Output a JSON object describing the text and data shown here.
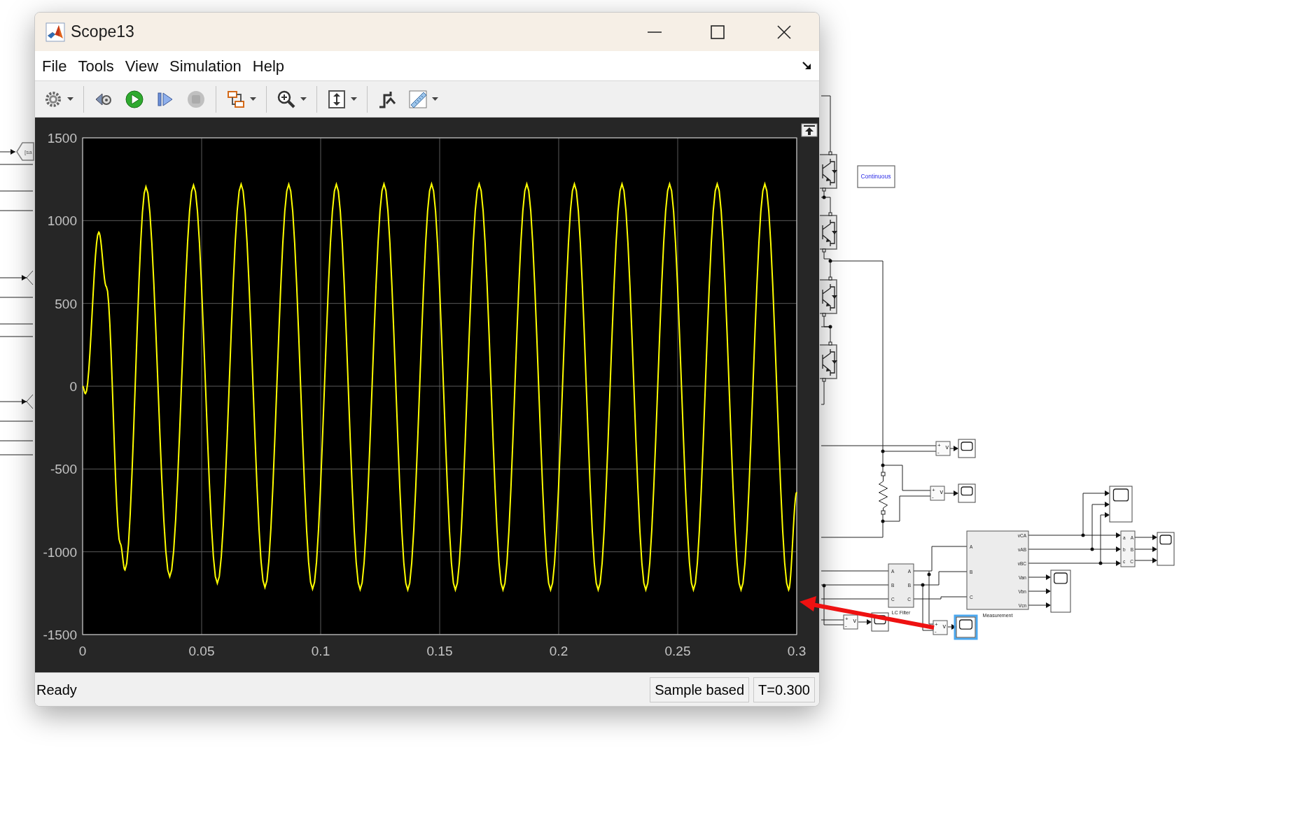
{
  "window": {
    "title": "Scope13"
  },
  "menu": [
    "File",
    "Tools",
    "View",
    "Simulation",
    "Help"
  ],
  "toolbar": [
    [
      {
        "kind": "settings",
        "dropdown": true,
        "disabled": false
      }
    ],
    [
      {
        "kind": "rewind",
        "dropdown": false,
        "disabled": false
      },
      {
        "kind": "run",
        "dropdown": false,
        "disabled": false
      },
      {
        "kind": "step",
        "dropdown": false,
        "disabled": false
      },
      {
        "kind": "stop",
        "dropdown": false,
        "disabled": true
      }
    ],
    [
      {
        "kind": "layout",
        "dropdown": true,
        "disabled": false
      }
    ],
    [
      {
        "kind": "zoom",
        "dropdown": true,
        "disabled": false
      }
    ],
    [
      {
        "kind": "fit",
        "dropdown": true,
        "disabled": false
      }
    ],
    [
      {
        "kind": "trigger",
        "dropdown": false,
        "disabled": false
      },
      {
        "kind": "measure",
        "dropdown": true,
        "disabled": false
      }
    ]
  ],
  "plot": {
    "chart_data": {
      "type": "line",
      "grid": true,
      "xlim": [
        0,
        0.3
      ],
      "ylim": [
        -1500,
        1500
      ],
      "xticks": [
        0,
        0.05,
        0.1,
        0.15,
        0.2,
        0.25,
        0.3
      ],
      "yticks": [
        -1500,
        -1000,
        -500,
        0,
        500,
        1000,
        1500
      ],
      "x": [
        0,
        0.0012,
        0.0068,
        0.01,
        0.0158,
        0.0178,
        0.0266,
        0.0366,
        0.0466,
        0.0566,
        0.0666,
        0.0766,
        0.0866,
        0.0966,
        0.1066,
        0.1166,
        0.1266,
        0.1366,
        0.1466,
        0.1566,
        0.1666,
        0.1766,
        0.1866,
        0.1966,
        0.2066,
        0.2166,
        0.2266,
        0.2366,
        0.2466,
        0.2566,
        0.2666,
        0.2766,
        0.2866,
        0.2966,
        0.3
      ],
      "series": [
        {
          "color": "#ffff00",
          "values": [
            0,
            -45,
            930,
            600,
            -950,
            -1110,
            1205,
            -1150,
            1215,
            -1190,
            1220,
            -1215,
            1220,
            -1225,
            1220,
            -1228,
            1222,
            -1230,
            1222,
            -1230,
            1222,
            -1230,
            1222,
            -1230,
            1222,
            -1230,
            1222,
            -1230,
            1222,
            -1230,
            1222,
            -1230,
            1222,
            -1230,
            -640
          ]
        }
      ]
    }
  },
  "status_bar": {
    "message": "Ready",
    "mode": "Sample based",
    "time": "T=0.300"
  },
  "diagram": {
    "goto_tag": "[sa",
    "solver_block": "Continuous",
    "lc_filter": {
      "name": "LC Filter",
      "inputs": [
        "A",
        "B",
        "C"
      ],
      "outputs": [
        "A",
        "B",
        "C"
      ]
    },
    "measurement": {
      "name": "Measurement",
      "inputs": [
        "A",
        "B",
        "C"
      ],
      "outputs": [
        "vCA",
        "vAB",
        "vBC",
        "Van",
        "Vbn",
        "Vcn"
      ]
    },
    "transform": {
      "inputs": [
        "a",
        "b",
        "c"
      ],
      "outputs": [
        "A",
        "B",
        "C"
      ]
    },
    "sensors": [
      {
        "plus": "+",
        "minus": "-",
        "output": "v"
      },
      {
        "plus": "+",
        "minus": "-",
        "output": "v"
      },
      {
        "plus": "+",
        "minus": "-",
        "output": "v"
      },
      {
        "plus": "+",
        "minus": "-",
        "output": "v"
      }
    ],
    "scopes": [
      {
        "selected": false
      },
      {
        "selected": false
      },
      {
        "selected": false
      },
      {
        "selected": false
      },
      {
        "selected": false
      },
      {
        "selected": false
      },
      {
        "selected": true
      }
    ]
  }
}
